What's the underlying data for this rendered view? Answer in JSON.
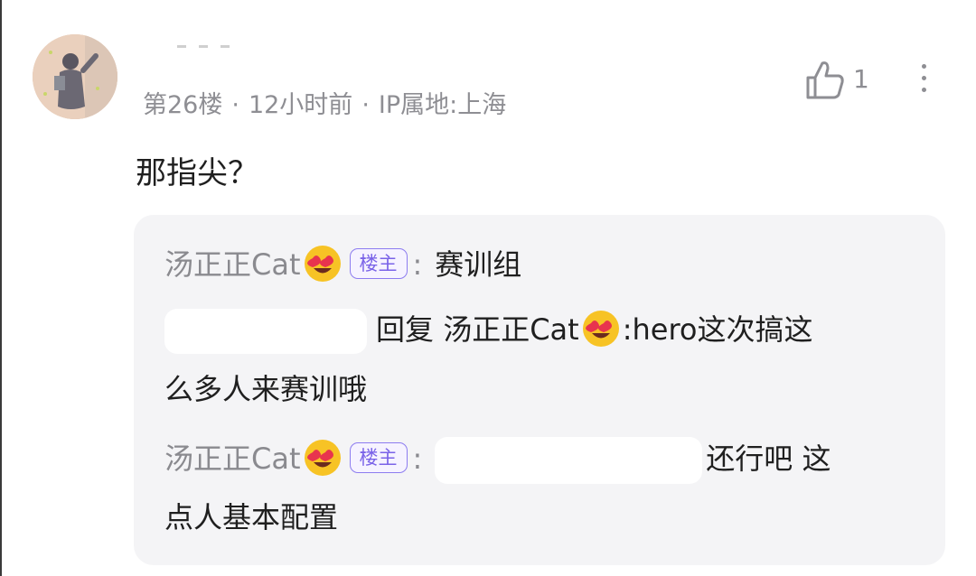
{
  "post": {
    "floor": "第26楼",
    "time": "12小时前",
    "ip": "IP属地:上海",
    "separator": "·",
    "like_count": "1",
    "content": "那指尖？"
  },
  "replies": {
    "badge_label": "楼主",
    "reply1": {
      "username": "汤正正Cat",
      "colon": ":",
      "text": "赛训组"
    },
    "reply2": {
      "reply_word": "回复",
      "target_user": "汤正正Cat",
      "text_part1": ":hero这次搞这",
      "text_part2": "么多人来赛训哦"
    },
    "reply3": {
      "username": "汤正正Cat",
      "colon": ":",
      "text_part1": "还行吧 这",
      "text_part2": "点人基本配置"
    }
  },
  "icons": {
    "like": "thumbs-up-icon",
    "more": "more-vertical-icon",
    "emoji": "heart-eyes-emoji"
  },
  "colors": {
    "meta_gray": "#8e8e93",
    "reply_bg": "#f4f4f6",
    "badge_purple": "#7a63e8"
  }
}
